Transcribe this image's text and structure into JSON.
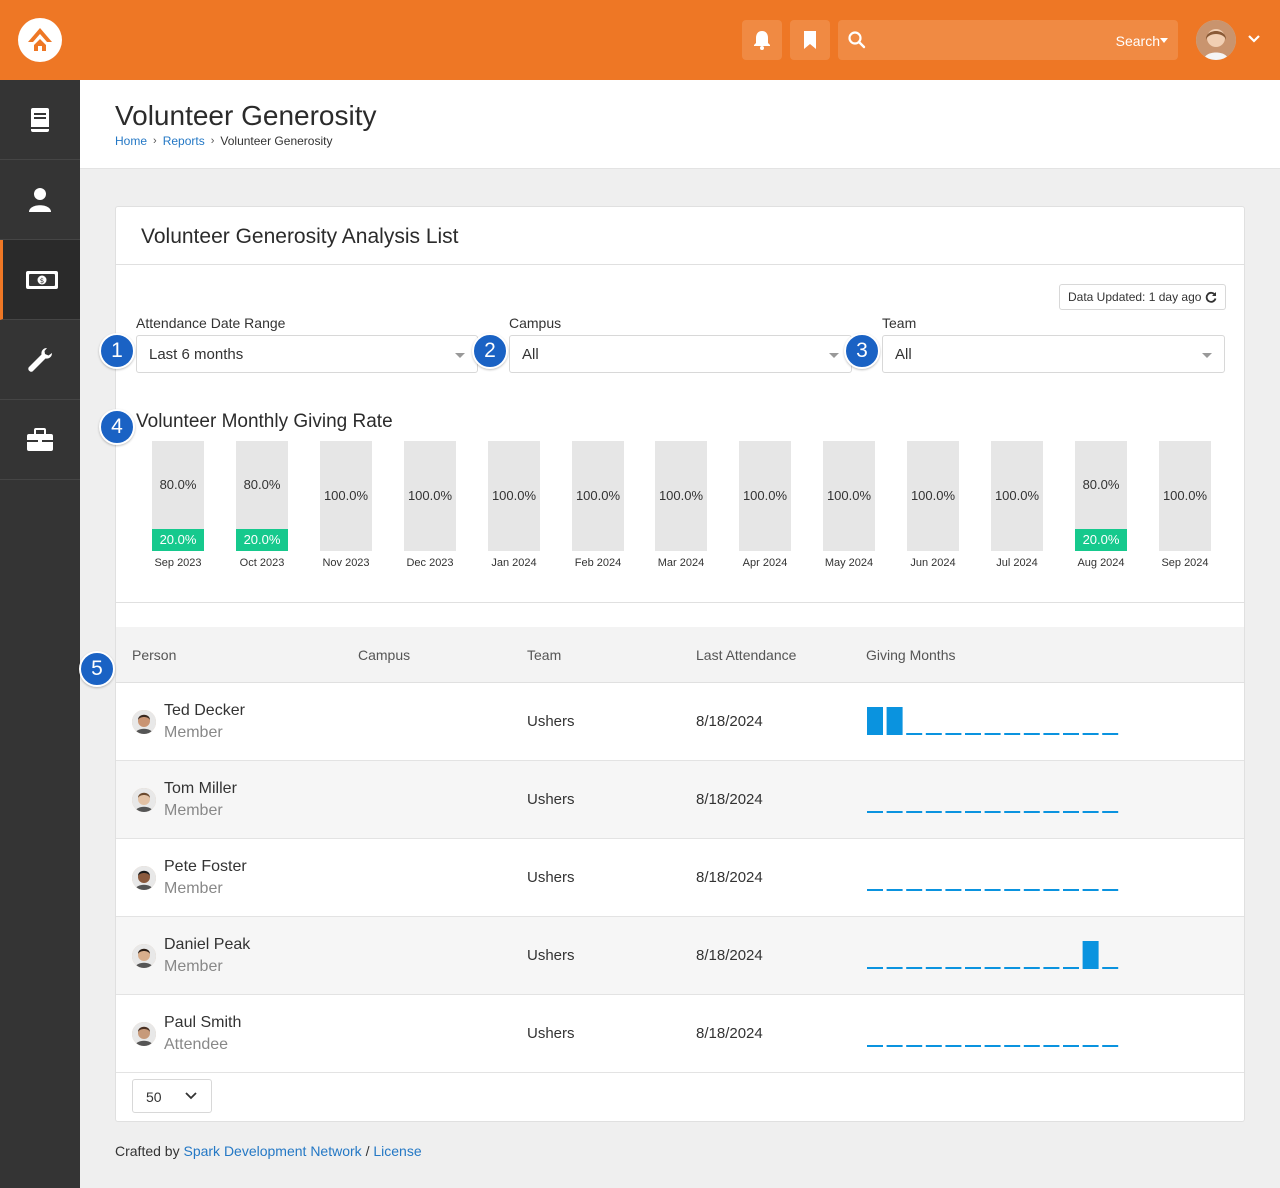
{
  "header": {
    "search_label": "Search"
  },
  "page": {
    "title": "Volunteer Generosity",
    "breadcrumb": [
      "Home",
      "Reports",
      "Volunteer Generosity"
    ]
  },
  "panel": {
    "title": "Volunteer Generosity Analysis List",
    "data_updated": "Data Updated: 1 day ago"
  },
  "filters": {
    "date_range": {
      "label": "Attendance Date Range",
      "value": "Last 6 months"
    },
    "campus": {
      "label": "Campus",
      "value": "All"
    },
    "team": {
      "label": "Team",
      "value": "All"
    }
  },
  "badges": [
    "1",
    "2",
    "3",
    "4",
    "5"
  ],
  "chart_data": {
    "type": "bar",
    "title": "Volunteer Monthly Giving Rate",
    "categories": [
      "Sep 2023",
      "Oct 2023",
      "Nov 2023",
      "Dec 2023",
      "Jan 2024",
      "Feb 2024",
      "Mar 2024",
      "Apr 2024",
      "May 2024",
      "Jun 2024",
      "Jul 2024",
      "Aug 2024",
      "Sep 2024"
    ],
    "series": [
      {
        "values": [
          20.0,
          20.0,
          0,
          0,
          0,
          0,
          0,
          0,
          0,
          0,
          0,
          20.0,
          0
        ]
      },
      {
        "values": [
          80.0,
          80.0,
          100.0,
          100.0,
          100.0,
          100.0,
          100.0,
          100.0,
          100.0,
          100.0,
          100.0,
          80.0,
          100.0
        ]
      }
    ],
    "colors": {
      "giving": "#16c98d",
      "not_giving": "#e6e6e6"
    }
  },
  "table": {
    "columns": [
      "Person",
      "Campus",
      "Team",
      "Last Attendance",
      "Giving Months"
    ],
    "rows": [
      {
        "name": "Ted Decker",
        "role": "Member",
        "campus": "",
        "team": "Ushers",
        "last_attendance": "8/18/2024",
        "giving_months": [
          1,
          1,
          0,
          0,
          0,
          0,
          0,
          0,
          0,
          0,
          0,
          0,
          0
        ]
      },
      {
        "name": "Tom Miller",
        "role": "Member",
        "campus": "",
        "team": "Ushers",
        "last_attendance": "8/18/2024",
        "giving_months": [
          0,
          0,
          0,
          0,
          0,
          0,
          0,
          0,
          0,
          0,
          0,
          0,
          0
        ]
      },
      {
        "name": "Pete Foster",
        "role": "Member",
        "campus": "",
        "team": "Ushers",
        "last_attendance": "8/18/2024",
        "giving_months": [
          0,
          0,
          0,
          0,
          0,
          0,
          0,
          0,
          0,
          0,
          0,
          0,
          0
        ]
      },
      {
        "name": "Daniel Peak",
        "role": "Member",
        "campus": "",
        "team": "Ushers",
        "last_attendance": "8/18/2024",
        "giving_months": [
          0,
          0,
          0,
          0,
          0,
          0,
          0,
          0,
          0,
          0,
          0,
          1,
          0
        ]
      },
      {
        "name": "Paul Smith",
        "role": "Attendee",
        "campus": "",
        "team": "Ushers",
        "last_attendance": "8/18/2024",
        "giving_months": [
          0,
          0,
          0,
          0,
          0,
          0,
          0,
          0,
          0,
          0,
          0,
          0,
          0
        ]
      }
    ],
    "page_size": "50"
  },
  "footer": {
    "prefix": "Crafted by",
    "link": "Spark Development Network",
    "sep": "/",
    "license": "License"
  },
  "colors": {
    "brand": "#ee7725",
    "accent": "#1a62c4",
    "spark": "#0a93df"
  }
}
